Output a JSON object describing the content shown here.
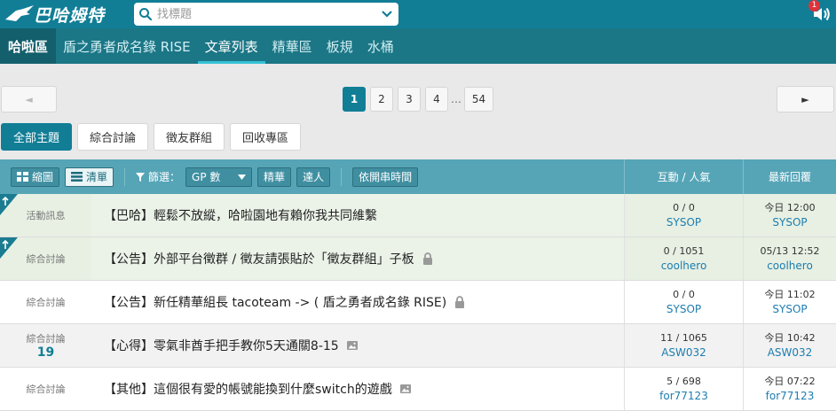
{
  "header": {
    "logo_text": "巴哈姆特",
    "search_placeholder": "找標題",
    "notification_count": "1"
  },
  "boardnav": {
    "home": "哈啦區",
    "items": [
      {
        "label": "盾之勇者成名錄 RISE"
      },
      {
        "label": "文章列表"
      },
      {
        "label": "精華區"
      },
      {
        "label": "板規"
      },
      {
        "label": "水桶"
      }
    ]
  },
  "pagination": {
    "prev": "◄",
    "next": "►",
    "pages": [
      "1",
      "2",
      "3",
      "4"
    ],
    "ellipsis": "…",
    "last": "54"
  },
  "categories": [
    "全部主題",
    "綜合討論",
    "徵友群組",
    "回收專區"
  ],
  "listheader": {
    "view_thumb": "縮圖",
    "view_list": "清單",
    "filter_label": "篩選：",
    "filter_value": "GP 數",
    "essence": "精華",
    "expert": "達人",
    "sort_time": "依開串時間",
    "col_stat": "互動 / 人氣",
    "col_last": "最新回覆"
  },
  "rows": [
    {
      "cat": "活動訊息",
      "count": "",
      "title": "【巴哈】輕鬆不放縱，哈啦園地有賴你我共同維繫",
      "stat": "0 / 0",
      "stat_user": "SYSOP",
      "last_time": "今日 12:00",
      "last_user": "SYSOP"
    },
    {
      "cat": "綜合討論",
      "count": "",
      "title": "【公告】外部平台徵群 / 徵友請張貼於「徵友群組」子板",
      "stat": "0 / 1051",
      "stat_user": "coolhero",
      "last_time": "05/13 12:52",
      "last_user": "coolhero"
    },
    {
      "cat": "綜合討論",
      "count": "",
      "title": "【公告】新任精華組長 tacoteam -> ( 盾之勇者成名錄 RISE)",
      "stat": "0 / 0",
      "stat_user": "SYSOP",
      "last_time": "今日 11:02",
      "last_user": "SYSOP"
    },
    {
      "cat": "綜合討論",
      "count": "19",
      "title": "【心得】零氣非酋手把手教你5天通關8-15",
      "stat": "11 / 1065",
      "stat_user": "ASW032",
      "last_time": "今日 10:42",
      "last_user": "ASW032"
    },
    {
      "cat": "綜合討論",
      "count": "",
      "title": "【其他】這個很有愛的帳號能換到什麼switch的遊戲",
      "stat": "5 / 698",
      "stat_user": "for77123",
      "last_time": "今日 07:22",
      "last_user": "for77123"
    }
  ]
}
